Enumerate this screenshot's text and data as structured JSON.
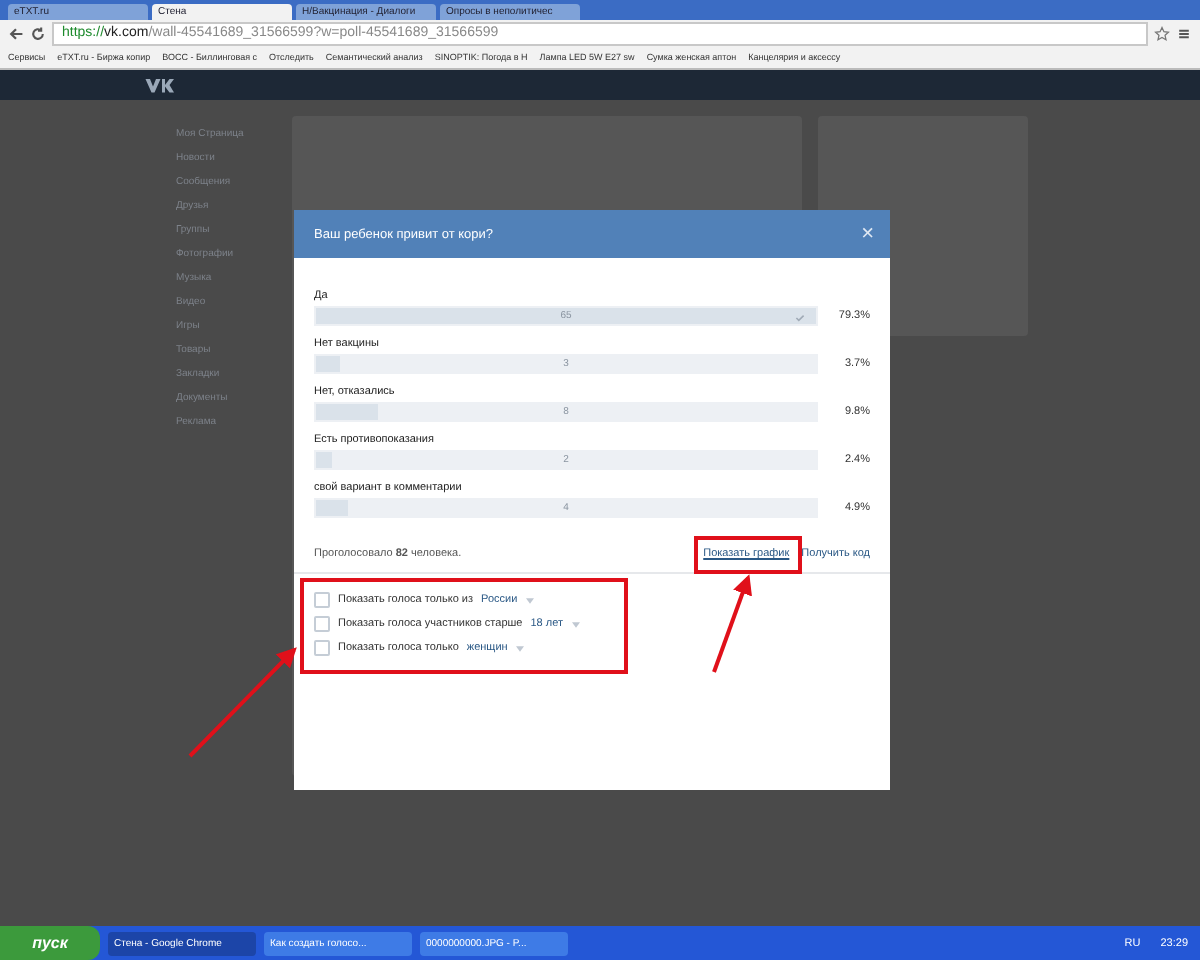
{
  "browser": {
    "tabs": [
      {
        "label": "eTXT.ru",
        "selected": false
      },
      {
        "label": "Стена",
        "selected": true
      },
      {
        "label": "Н/Вакцинация - Диалоги",
        "selected": false
      },
      {
        "label": "Опросы в неполитичес",
        "selected": false
      }
    ],
    "url": {
      "secure": "https://",
      "host": "vk.com",
      "path": "/wall-45541689_31566599?w=poll-45541689_31566599"
    },
    "bookmarks": [
      "Сервисы",
      "eTXT.ru - Биржа копир",
      "ВОСС - Биллинговая с",
      "Отследить",
      "Семантический анализ",
      "SINOPTIK: Погода в Н",
      "Лампа LED 5W E27 sw",
      "Сумка женская аптон",
      "Канцелярия и аксессу"
    ]
  },
  "sidebar": {
    "items": [
      "Моя Страница",
      "Новости",
      "Сообщения",
      "Друзья",
      "Группы",
      "Фотографии",
      "Музыка",
      "Видео",
      "Игры",
      "Товары",
      "Закладки",
      "Документы",
      "Реклама"
    ]
  },
  "poll": {
    "title": "Ваш ребенок привит от кори?",
    "close": "×",
    "options": [
      {
        "label": "Да",
        "count": "65",
        "percent": "79.3%",
        "level": 1,
        "voted": true
      },
      {
        "label": "Нет вакцины",
        "count": "3",
        "percent": "3.7%",
        "level": 0.046,
        "voted": false
      },
      {
        "label": "Нет, отказались",
        "count": "8",
        "percent": "9.8%",
        "level": 0.123,
        "voted": false
      },
      {
        "label": "Есть противопоказания",
        "count": "2",
        "percent": "2.4%",
        "level": 0.031,
        "voted": false
      },
      {
        "label": "свой вариант в комментарии",
        "count": "4",
        "percent": "4.9%",
        "level": 0.062,
        "voted": false
      }
    ],
    "total": "Проголосовало **82** человека.",
    "links": [
      "Показать график",
      "Получить код"
    ],
    "filters": [
      {
        "text": "Показать голоса только из",
        "value": "России",
        "checked": false
      },
      {
        "text": "Показать голоса участников старше",
        "value": "18 лет",
        "checked": false
      },
      {
        "text": "Показать голоса только",
        "value": "женщин",
        "checked": false
      }
    ]
  },
  "taskbar": {
    "start": "пуск",
    "windows": [
      {
        "label": "Стена - Google Chrome",
        "selected": true
      },
      {
        "label": "Как создать голосо...",
        "selected": false
      },
      {
        "label": "0000000000.JPG - P...",
        "selected": false
      }
    ],
    "lang": "RU",
    "clock": "23:29"
  }
}
